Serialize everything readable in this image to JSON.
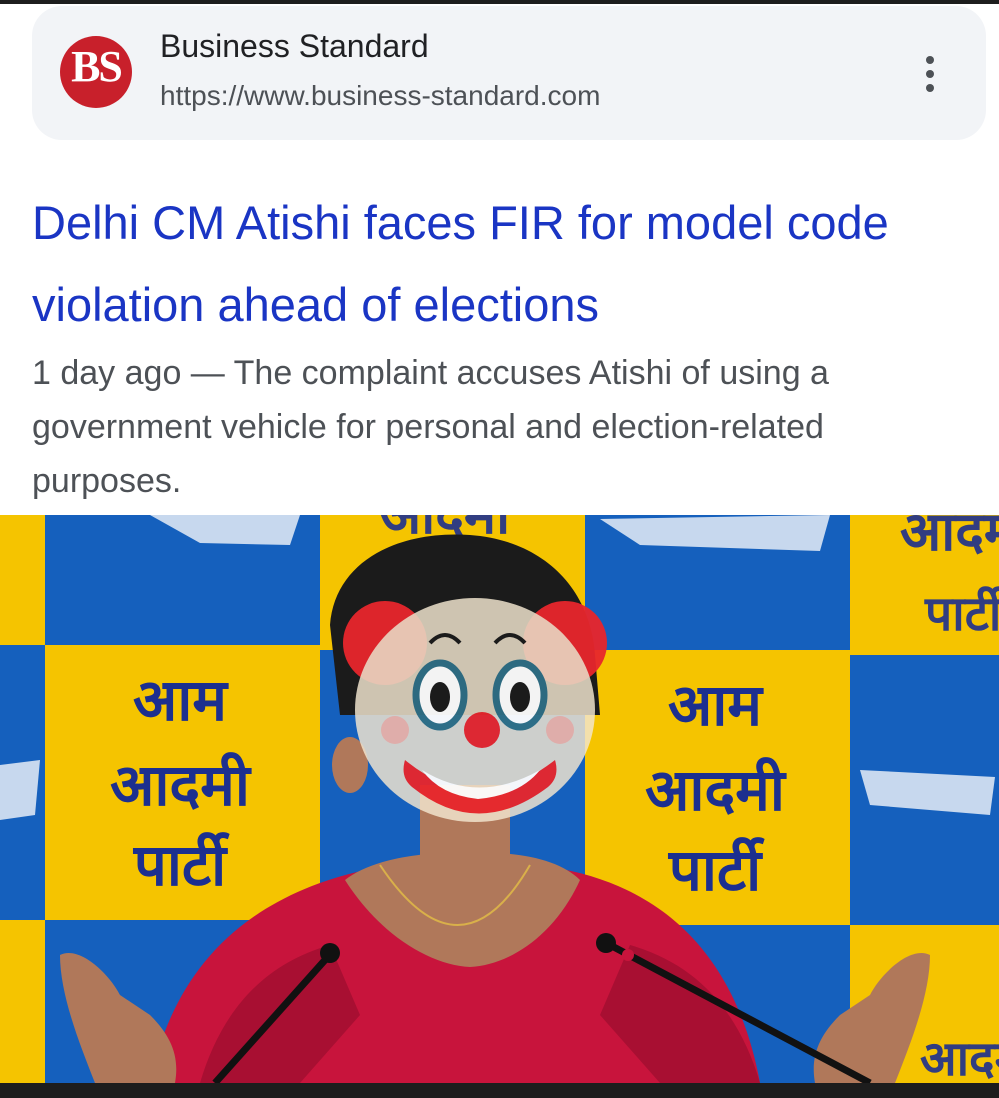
{
  "result": {
    "source": {
      "logo_text": "BS",
      "name": "Business Standard",
      "url": "https://www.business-standard.com"
    },
    "title": "Delhi CM Atishi faces FIR for model code violation ahead of elections",
    "snippet": {
      "age": "1 day ago",
      "separator": " — ",
      "text": "The complaint accuses Atishi of using a government vehicle for personal and election-related purposes."
    }
  },
  "image": {
    "backdrop_text_lines": [
      "आम",
      "आदमी",
      "पार्टी"
    ],
    "overlay_icon": "clown-face-emoji",
    "colors": {
      "backdrop_blue": "#1560bd",
      "backdrop_yellow": "#f5c400",
      "party_text": "#1c2f8f",
      "dupatta": "#c8143c",
      "clown_red": "#e8262c"
    }
  },
  "colors": {
    "link_blue": "#1a35c4",
    "snippet_gray": "#4d5156",
    "card_bg": "#f2f4f7"
  }
}
